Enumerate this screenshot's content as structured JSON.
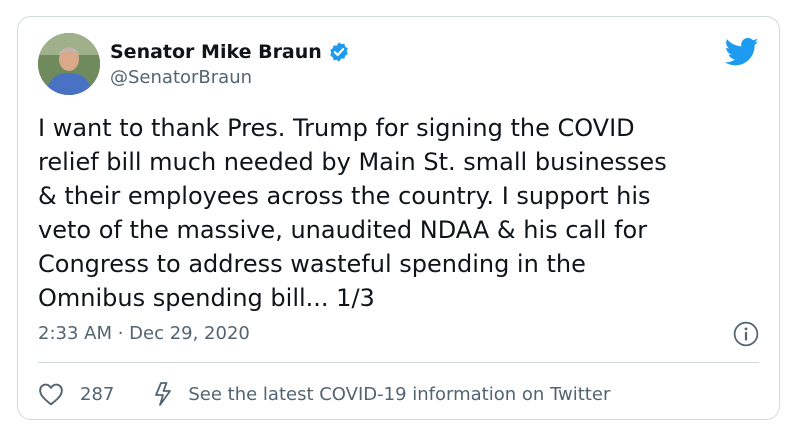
{
  "author": {
    "display_name": "Senator Mike Braun",
    "handle": "@SenatorBraun",
    "verified": true
  },
  "tweet": {
    "lines": [
      "I want to thank Pres. Trump for signing the COVID",
      "relief bill much needed by Main St. small businesses",
      "& their employees across the country. I support his",
      "veto of the massive, unaudited NDAA & his call for",
      "Congress to address wasteful spending in the",
      "Omnibus spending bill... 1/3"
    ],
    "timestamp": "2:33 AM · Dec 29, 2020"
  },
  "actions": {
    "like_count": "287",
    "covid_link": "See the latest COVID-19 information on Twitter"
  },
  "icons": {
    "brand": "twitter-bird-icon",
    "verified": "verified-badge-icon",
    "info": "info-icon",
    "like": "heart-icon",
    "covid": "bolt-icon"
  },
  "colors": {
    "twitter_blue": "#1d9bf0",
    "text_primary": "#0f1419",
    "text_secondary": "#536471",
    "border": "#cfd9de"
  }
}
